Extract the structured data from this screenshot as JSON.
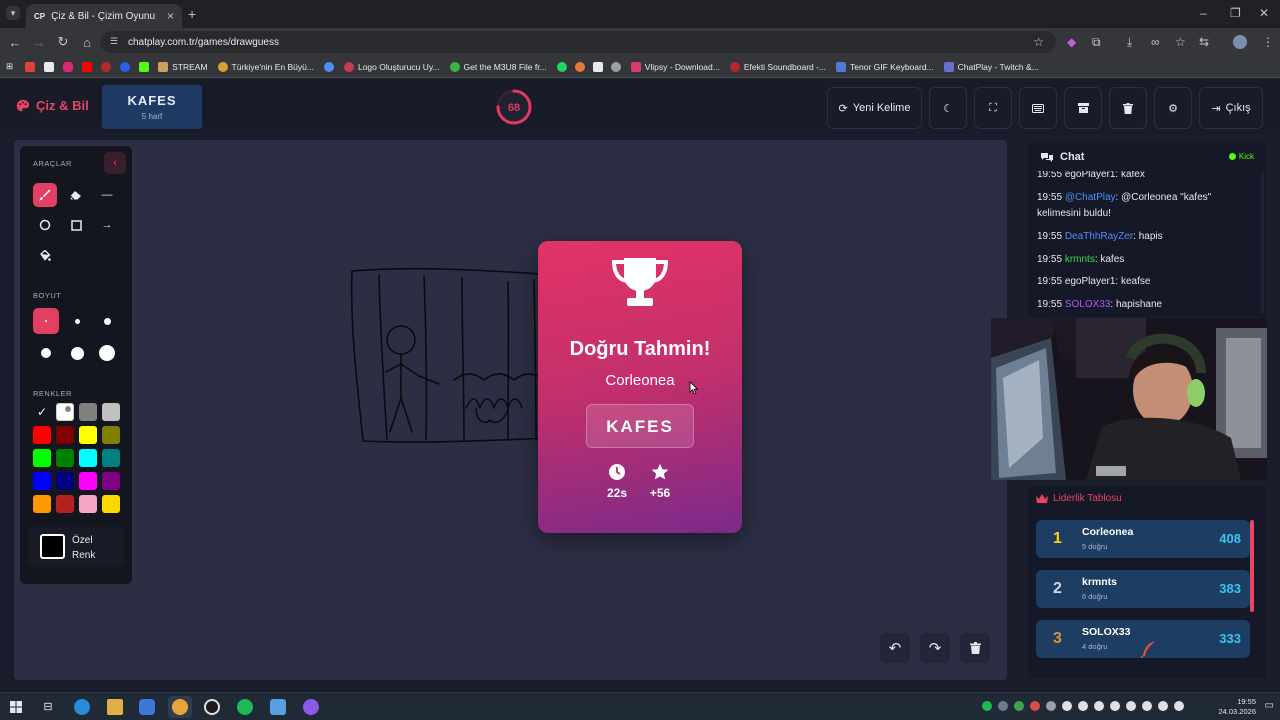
{
  "browser": {
    "tab_title": "Çiz & Bil - Çizim Oyunu",
    "tab_favicon": "CP",
    "url": "chatplay.com.tr/games/drawguess",
    "bookmarks": [
      {
        "label": "STREAM",
        "icon": "folder-icon",
        "color": "#c9a15a"
      },
      {
        "label": "Türkiye'nin En Büyü...",
        "icon": "site-icon",
        "color": "#d6a231"
      },
      {
        "label": "Logo Oluşturucu Uy...",
        "icon": "site-icon",
        "color": "#c43a4e"
      },
      {
        "label": "Get the M3U8 File fr...",
        "icon": "site-icon",
        "color": "#3bb34a"
      },
      {
        "label": "Vlipsy - Download...",
        "icon": "site-icon",
        "color": "#d83c6a"
      },
      {
        "label": "Efekti Soundboard -...",
        "icon": "site-icon",
        "color": "#b8262c"
      },
      {
        "label": "Tenor GIF Keyboard...",
        "icon": "site-icon",
        "color": "#4f7ad8"
      },
      {
        "label": "ChatPlay - Twitch &...",
        "icon": "site-icon",
        "color": "#6a6fcf"
      }
    ]
  },
  "app": {
    "logo": "Çiz & Bil",
    "word": "KAFES",
    "word_hint": "5 harf",
    "timer": "68",
    "timer_fraction": 0.75,
    "buttons": {
      "new_word": "Yeni Kelime",
      "exit": "Çıkış"
    }
  },
  "tools": {
    "section_tools": "ARAÇLAR",
    "section_size": "BOYUT",
    "section_colors": "RENKLER",
    "custom_color": "Özel",
    "custom_color_2": "Renk",
    "colors": [
      "#111111",
      "#ffffff",
      "#808080",
      "#c0c0c0",
      "#ff0000",
      "#800000",
      "#ffff00",
      "#808000",
      "#00ff00",
      "#008000",
      "#00ffff",
      "#008080",
      "#0000ff",
      "#000080",
      "#ff00ff",
      "#800080",
      "#ff9900",
      "#b22222",
      "#f4a6c4",
      "#ffd700"
    ]
  },
  "result": {
    "title": "Doğru Tahmin!",
    "user": "Corleonea",
    "word": "KAFES",
    "time": "22s",
    "points": "+56"
  },
  "chat": {
    "title": "Chat",
    "platform": "Kick",
    "messages": [
      {
        "time": "19:55",
        "user": "egoPlayer1",
        "user_color": "#e6e8ef",
        "text": ": kafex"
      },
      {
        "time": "19:55",
        "user": "@ChatPlay",
        "user_color": "#4f8ff7",
        "text": ": @Corleonea \"kafes\" kelimesini buldu!"
      },
      {
        "time": "19:55",
        "user": "DeaThhRayZer",
        "user_color": "#4f8ff7",
        "text": ": hapis"
      },
      {
        "time": "19:55",
        "user": "krmnts",
        "user_color": "#3fd84a",
        "text": ": kafes"
      },
      {
        "time": "19:55",
        "user": "egoPlayer1",
        "user_color": "#e6e8ef",
        "text": ": keafse"
      },
      {
        "time": "19:55",
        "user": "SOLOX33",
        "user_color": "#b25af0",
        "text": ": hapishane"
      }
    ]
  },
  "leaderboard": {
    "title": "Liderlik Tablosu",
    "rows": [
      {
        "rank": "1",
        "name": "Corleonea",
        "sub": "5 doğru",
        "score": "408",
        "rank_color": "#f5d320"
      },
      {
        "rank": "2",
        "name": "krmnts",
        "sub": "6 doğru",
        "score": "383",
        "rank_color": "#d4d7de"
      },
      {
        "rank": "3",
        "name": "SOLOX33",
        "sub": "4 doğru",
        "score": "333",
        "rank_color": "#d8903a"
      }
    ]
  },
  "taskbar": {
    "time": "19:55",
    "date": "24.03.2026"
  }
}
